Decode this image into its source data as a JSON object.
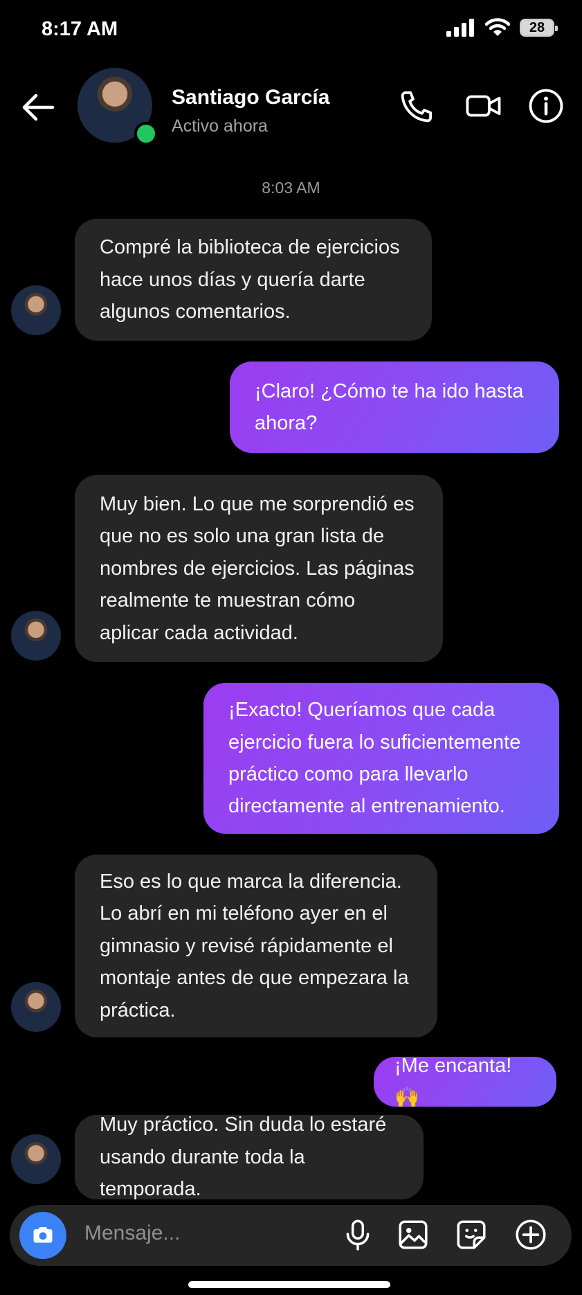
{
  "status_bar": {
    "time": "8:17 AM",
    "battery": "28"
  },
  "header": {
    "contact_name": "Santiago García",
    "contact_status": "Activo ahora"
  },
  "timestamp": "8:03 AM",
  "messages": [
    {
      "from": "them",
      "text": "Compré la biblioteca de ejercicios hace unos días y quería darte algunos comentarios."
    },
    {
      "from": "me",
      "text": "¡Claro! ¿Cómo te ha ido hasta ahora?"
    },
    {
      "from": "them",
      "text": "Muy bien. Lo que me sorprendió es que no es solo una gran lista de nombres de ejercicios. Las páginas realmente te muestran cómo aplicar cada actividad."
    },
    {
      "from": "me",
      "text": "¡Exacto! Queríamos que cada ejercicio fuera lo suficientemente práctico como para llevarlo directamente al entrenamiento."
    },
    {
      "from": "them",
      "text": "Eso es lo que marca la diferencia. Lo abrí en mi teléfono ayer en el gimnasio y revisé rápidamente el montaje antes de que empezara la práctica."
    },
    {
      "from": "me",
      "text": "¡Me encanta! 🙌"
    },
    {
      "from": "them",
      "text": "Muy práctico. Sin duda lo estaré usando durante toda la temporada."
    }
  ],
  "composer": {
    "placeholder": "Mensaje..."
  },
  "colors": {
    "outgoing_start": "#9b3df0",
    "outgoing_end": "#6f5ef6",
    "incoming": "#262626",
    "online": "#22c55e",
    "camera": "#3b82f6"
  }
}
